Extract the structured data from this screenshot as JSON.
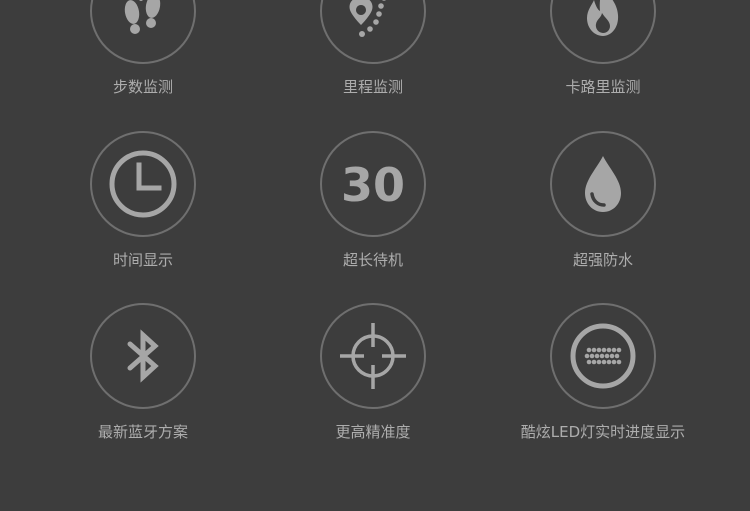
{
  "features": [
    {
      "label": "步数监测",
      "icon": "footprints-icon"
    },
    {
      "label": "里程监测",
      "icon": "location-route-icon"
    },
    {
      "label": "卡路里监测",
      "icon": "flame-icon"
    },
    {
      "label": "时间显示",
      "icon": "clock-icon"
    },
    {
      "label": "超长待机",
      "icon": "standby-30-icon",
      "icon_text": "30"
    },
    {
      "label": "超强防水",
      "icon": "water-drop-icon"
    },
    {
      "label": "最新蓝牙方案",
      "icon": "bluetooth-icon"
    },
    {
      "label": "更高精准度",
      "icon": "crosshair-icon"
    },
    {
      "label": "酷炫LED灯实时进度显示",
      "icon": "led-display-icon"
    }
  ],
  "colors": {
    "background": "#3d3d3d",
    "ring": "#6f6f6f",
    "icon": "#a6a6a6",
    "label": "#adadad"
  }
}
